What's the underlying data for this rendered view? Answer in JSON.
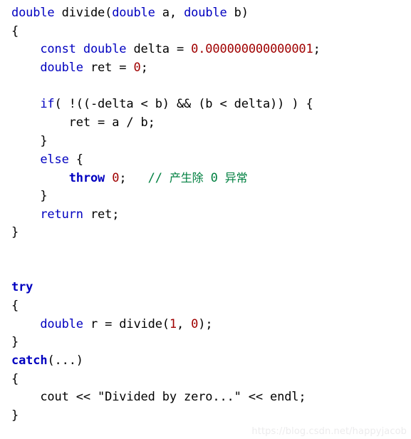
{
  "page": {
    "kind": "code-snippet-image",
    "language": "cpp",
    "background_color": "#ffffff",
    "colors": {
      "plain": "#000000",
      "keyword": "#0000c0",
      "number": "#a00000",
      "comment": "#008040",
      "watermark": "#ececed"
    }
  },
  "watermark": {
    "text": "https://blog.csdn.net/happyjacob"
  },
  "code": {
    "lines": [
      {
        "index": 1,
        "text": "double divide(double a, double b)",
        "tokens": [
          {
            "t": "double",
            "c": "kw"
          },
          {
            "t": " divide(",
            "c": "plain"
          },
          {
            "t": "double",
            "c": "kw"
          },
          {
            "t": " a, ",
            "c": "plain"
          },
          {
            "t": "double",
            "c": "kw"
          },
          {
            "t": " b)",
            "c": "plain"
          }
        ]
      },
      {
        "index": 2,
        "text": "{",
        "tokens": [
          {
            "t": "{",
            "c": "plain"
          }
        ]
      },
      {
        "index": 3,
        "text": "    const double delta = 0.000000000000001;",
        "tokens": [
          {
            "t": "    ",
            "c": "plain"
          },
          {
            "t": "const double",
            "c": "kw"
          },
          {
            "t": " delta = ",
            "c": "plain"
          },
          {
            "t": "0.000000000000001",
            "c": "num"
          },
          {
            "t": ";",
            "c": "plain"
          }
        ]
      },
      {
        "index": 4,
        "text": "    double ret = 0;",
        "tokens": [
          {
            "t": "    ",
            "c": "plain"
          },
          {
            "t": "double",
            "c": "kw"
          },
          {
            "t": " ret = ",
            "c": "plain"
          },
          {
            "t": "0",
            "c": "num"
          },
          {
            "t": ";",
            "c": "plain"
          }
        ]
      },
      {
        "index": 5,
        "text": "",
        "tokens": [
          {
            "t": " ",
            "c": "plain"
          }
        ]
      },
      {
        "index": 6,
        "text": "    if( !((-delta < b) && (b < delta)) ) {",
        "tokens": [
          {
            "t": "    ",
            "c": "plain"
          },
          {
            "t": "if",
            "c": "kw"
          },
          {
            "t": "( !((-delta < b) && (b < delta)) ) {",
            "c": "plain"
          }
        ]
      },
      {
        "index": 7,
        "text": "        ret = a / b;",
        "tokens": [
          {
            "t": "        ret = a / b;",
            "c": "plain"
          }
        ]
      },
      {
        "index": 8,
        "text": "    }",
        "tokens": [
          {
            "t": "    }",
            "c": "plain"
          }
        ]
      },
      {
        "index": 9,
        "text": "    else {",
        "tokens": [
          {
            "t": "    ",
            "c": "plain"
          },
          {
            "t": "else",
            "c": "kw"
          },
          {
            "t": " {",
            "c": "plain"
          }
        ]
      },
      {
        "index": 10,
        "text": "        throw 0;   // 产生除 0 异常",
        "tokens": [
          {
            "t": "        ",
            "c": "plain"
          },
          {
            "t": "throw",
            "c": "kw-b"
          },
          {
            "t": " ",
            "c": "plain"
          },
          {
            "t": "0",
            "c": "num"
          },
          {
            "t": ";   ",
            "c": "plain"
          },
          {
            "t": "// ",
            "c": "comment"
          },
          {
            "t": "产生除",
            "c": "comment-cjk"
          },
          {
            "t": " 0 ",
            "c": "comment"
          },
          {
            "t": "异常",
            "c": "comment-cjk"
          }
        ]
      },
      {
        "index": 11,
        "text": "    }",
        "tokens": [
          {
            "t": "    }",
            "c": "plain"
          }
        ]
      },
      {
        "index": 12,
        "text": "    return ret;",
        "tokens": [
          {
            "t": "    ",
            "c": "plain"
          },
          {
            "t": "return",
            "c": "kw"
          },
          {
            "t": " ret;",
            "c": "plain"
          }
        ]
      },
      {
        "index": 13,
        "text": "}",
        "tokens": [
          {
            "t": "}",
            "c": "plain"
          }
        ]
      },
      {
        "index": 14,
        "text": "",
        "tokens": [
          {
            "t": " ",
            "c": "plain"
          }
        ]
      },
      {
        "index": 15,
        "text": "",
        "tokens": [
          {
            "t": " ",
            "c": "plain"
          }
        ]
      },
      {
        "index": 16,
        "text": "try",
        "tokens": [
          {
            "t": "try",
            "c": "kw-b"
          }
        ]
      },
      {
        "index": 17,
        "text": "{",
        "tokens": [
          {
            "t": "{",
            "c": "plain"
          }
        ]
      },
      {
        "index": 18,
        "text": "    double r = divide(1, 0);",
        "tokens": [
          {
            "t": "    ",
            "c": "plain"
          },
          {
            "t": "double",
            "c": "kw"
          },
          {
            "t": " r = divide(",
            "c": "plain"
          },
          {
            "t": "1",
            "c": "num"
          },
          {
            "t": ", ",
            "c": "plain"
          },
          {
            "t": "0",
            "c": "num"
          },
          {
            "t": ");",
            "c": "plain"
          }
        ]
      },
      {
        "index": 19,
        "text": "}",
        "tokens": [
          {
            "t": "}",
            "c": "plain"
          }
        ]
      },
      {
        "index": 20,
        "text": "catch(...)",
        "tokens": [
          {
            "t": "catch",
            "c": "kw-b"
          },
          {
            "t": "(...)",
            "c": "plain"
          }
        ]
      },
      {
        "index": 21,
        "text": "{",
        "tokens": [
          {
            "t": "{",
            "c": "plain"
          }
        ]
      },
      {
        "index": 22,
        "text": "    cout << \"Divided by zero...\" << endl;",
        "tokens": [
          {
            "t": "    cout << \"Divided by zero...\" << endl;",
            "c": "plain"
          }
        ]
      },
      {
        "index": 23,
        "text": "}",
        "tokens": [
          {
            "t": "}",
            "c": "plain"
          }
        ]
      }
    ]
  }
}
